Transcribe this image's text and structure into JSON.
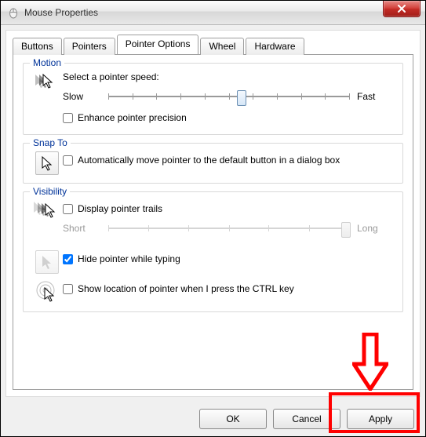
{
  "window": {
    "title": "Mouse Properties"
  },
  "close": {
    "label": "Close"
  },
  "tabs": [
    {
      "label": "Buttons"
    },
    {
      "label": "Pointers"
    },
    {
      "label": "Pointer Options"
    },
    {
      "label": "Wheel"
    },
    {
      "label": "Hardware"
    }
  ],
  "motion": {
    "legend": "Motion",
    "prompt": "Select a pointer speed:",
    "slow": "Slow",
    "fast": "Fast",
    "enhance": "Enhance pointer precision"
  },
  "snap": {
    "legend": "Snap To",
    "auto": "Automatically move pointer to the default button in a dialog box"
  },
  "visibility": {
    "legend": "Visibility",
    "trails": "Display pointer trails",
    "short": "Short",
    "long": "Long",
    "hide": "Hide pointer while typing",
    "ctrl": "Show location of pointer when I press the CTRL key"
  },
  "buttons": {
    "ok": "OK",
    "cancel": "Cancel",
    "apply": "Apply"
  }
}
